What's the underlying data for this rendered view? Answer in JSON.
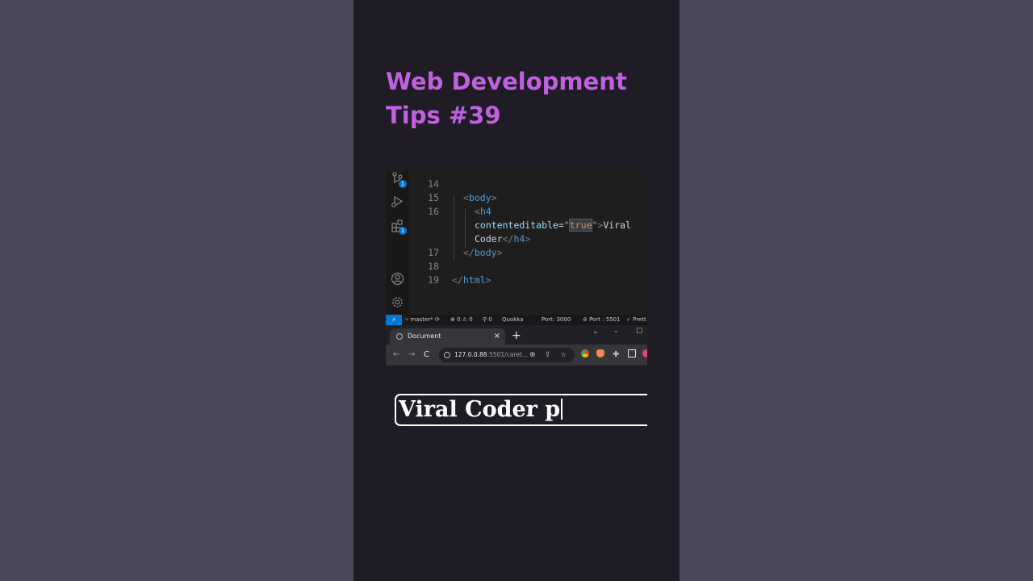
{
  "title": {
    "line1": "Web Development",
    "line2": "Tips #39"
  },
  "editor": {
    "lines": [
      {
        "num": "15",
        "open": "<",
        "name": "body",
        "close": ">"
      },
      {
        "num": "16"
      },
      {
        "num": "17",
        "open": "</",
        "name": "body",
        "close": ">"
      },
      {
        "num": "18"
      },
      {
        "num": "19",
        "open": "</",
        "name": "html",
        "close": ">"
      }
    ],
    "line14": "14",
    "h4_open": "<",
    "h4_name": "h4",
    "attr_name": "contenteditable",
    "attr_eq": "=",
    "attr_quote_open": "\"",
    "attr_value": "true",
    "attr_quote_close": "\"",
    "tag_gt": ">",
    "text1": "Viral",
    "text2": "Coder",
    "h4_close_open": "</",
    "h4_close_name": "h4",
    "h4_close_gt": ">",
    "badge_git": "1",
    "badge_ext": "1"
  },
  "statusbar": {
    "remote": "⚡",
    "branch": "master*",
    "errors": "⊗ 0 ⚠ 0",
    "ports": "⚲ 0",
    "quokka": "Quokka",
    "port3000": "Port: 3000",
    "port5501": "⊘ Port : 5501",
    "prettier": "✓ Prett"
  },
  "browser": {
    "tab_title": "Document",
    "tab_close": "×",
    "new_tab": "+",
    "url_host": "127.0.0.88",
    "url_path": ":5501/caret...",
    "back": "←",
    "forward": "→",
    "reload": "C"
  },
  "preview": {
    "text": "Viral Coder p"
  }
}
